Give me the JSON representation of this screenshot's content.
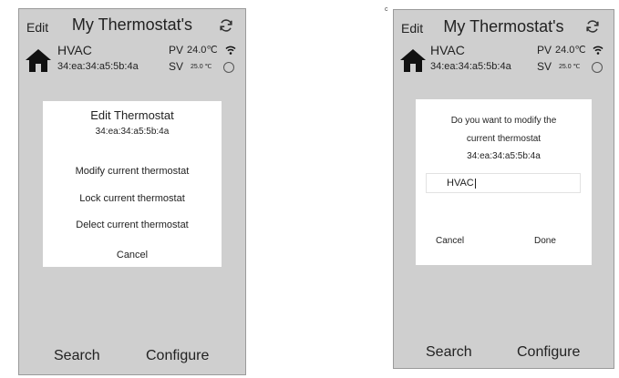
{
  "corner_mark": "c",
  "screens": {
    "left": {
      "header": {
        "edit": "Edit",
        "title": "My Thermostat's"
      },
      "device": {
        "name": "HVAC",
        "mac": "34:ea:34:a5:5b:4a",
        "pv_label": "PV",
        "pv_value": "24.0℃",
        "sv_label": "SV",
        "sv_value": "25.0 ℃"
      },
      "dialog": {
        "title": "Edit Thermostat",
        "mac": "34:ea:34:a5:5b:4a",
        "options": [
          "Modify current thermostat",
          "Lock current thermostat",
          "Delect current thermostat"
        ],
        "cancel": "Cancel"
      },
      "bottom": {
        "search": "Search",
        "configure": "Configure"
      }
    },
    "right": {
      "header": {
        "edit": "Edit",
        "title": "My Thermostat's"
      },
      "device": {
        "name": "HVAC",
        "mac": "34:ea:34:a5:5b:4a",
        "pv_label": "PV",
        "pv_value": "24.0℃",
        "sv_label": "SV",
        "sv_value": "25.0 ℃"
      },
      "dialog": {
        "line1": "Do you want to modify the",
        "line2": "current thermostat",
        "mac": "34:ea:34:a5:5b:4a",
        "input_value": "HVAC",
        "cancel": "Cancel",
        "done": "Done"
      },
      "bottom": {
        "search": "Search",
        "configure": "Configure"
      }
    }
  }
}
